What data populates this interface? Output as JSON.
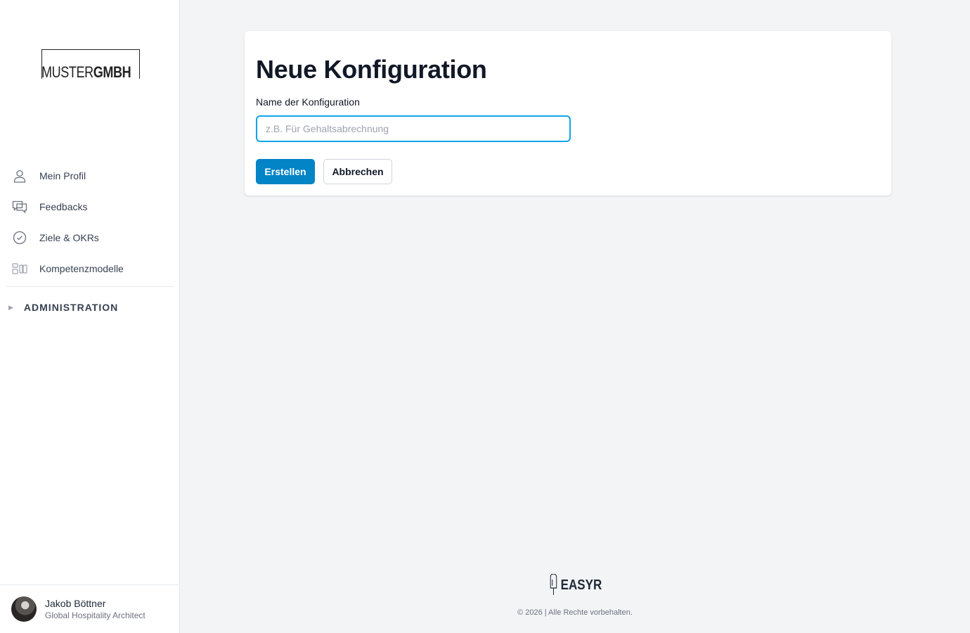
{
  "brand": {
    "logo_light": "MUSTER",
    "logo_bold": "GMBH"
  },
  "sidebar": {
    "items": [
      {
        "label": "Mein Profil",
        "icon": "user-icon"
      },
      {
        "label": "Feedbacks",
        "icon": "chat-icon"
      },
      {
        "label": "Ziele & OKRs",
        "icon": "check-circle-icon"
      },
      {
        "label": "Kompetenzmodelle",
        "icon": "grid-icon"
      }
    ],
    "admin_label": "ADMINISTRATION"
  },
  "user": {
    "name": "Jakob Böttner",
    "role": "Global Hospitality Architect"
  },
  "form": {
    "title": "Neue Konfiguration",
    "field_label": "Name der Konfiguration",
    "placeholder": "z.B. Für Gehaltsabrechnung",
    "value": "",
    "create_label": "Erstellen",
    "cancel_label": "Abbrechen"
  },
  "footer": {
    "logo_text": "EASYR",
    "copyright": "© 2026 | Alle Rechte vorbehalten."
  },
  "colors": {
    "primary": "#0284c7",
    "focus": "#0ea5e9",
    "background": "#f3f4f6"
  }
}
